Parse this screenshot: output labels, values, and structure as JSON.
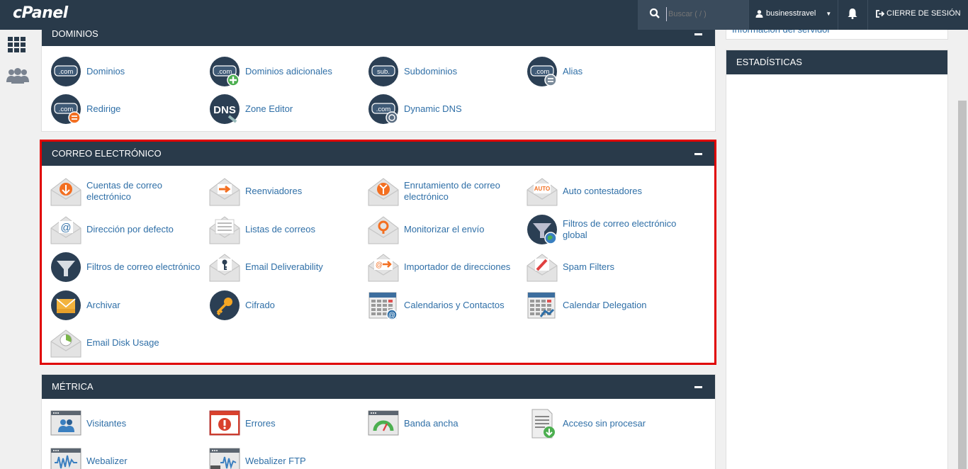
{
  "app": {
    "logo": "cPanel"
  },
  "topbar": {
    "search_placeholder": "Buscar ( / )",
    "username": "businesstravel",
    "logout_label": "CIERRE DE SESIÓN"
  },
  "sidebar": {
    "items": [
      {
        "icon": "grid-icon"
      },
      {
        "icon": "users-icon"
      }
    ]
  },
  "right": {
    "server_info_link": "Información del servidor",
    "stats_title": "ESTADÍSTICAS"
  },
  "sections": {
    "domains": {
      "title": "DOMINIOS",
      "items": [
        {
          "label": "Dominios",
          "icon": "com-icon"
        },
        {
          "label": "Dominios adicionales",
          "icon": "com-add-icon"
        },
        {
          "label": "Subdominios",
          "icon": "sub-icon"
        },
        {
          "label": "Alias",
          "icon": "com-alias-icon"
        },
        {
          "label": "Redirige",
          "icon": "com-redirect-icon"
        },
        {
          "label": "Zone Editor",
          "icon": "dns-icon"
        },
        {
          "label": "Dynamic DNS",
          "icon": "com-dynamic-icon"
        }
      ]
    },
    "email": {
      "title": "CORREO ELECTRÓNICO",
      "items": [
        {
          "label": "Cuentas de correo electrónico",
          "icon": "email-account-icon"
        },
        {
          "label": "Reenviadores",
          "icon": "forwarder-icon"
        },
        {
          "label": "Enrutamiento de correo electrónico",
          "icon": "routing-icon"
        },
        {
          "label": "Auto contestadores",
          "icon": "autoresponder-icon"
        },
        {
          "label": "Dirección por defecto",
          "icon": "default-address-icon"
        },
        {
          "label": "Listas de correos",
          "icon": "mailing-list-icon"
        },
        {
          "label": "Monitorizar el envío",
          "icon": "track-delivery-icon"
        },
        {
          "label": "Filtros de correo electrónico global",
          "icon": "global-filter-icon"
        },
        {
          "label": "Filtros de correo electrónico",
          "icon": "filter-icon"
        },
        {
          "label": "Email Deliverability",
          "icon": "deliverability-icon"
        },
        {
          "label": "Importador de direcciones",
          "icon": "import-icon"
        },
        {
          "label": "Spam Filters",
          "icon": "spam-icon"
        },
        {
          "label": "Archivar",
          "icon": "archive-icon"
        },
        {
          "label": "Cifrado",
          "icon": "key-icon"
        },
        {
          "label": "Calendarios y Contactos",
          "icon": "calendar-contacts-icon"
        },
        {
          "label": "Calendar Delegation",
          "icon": "calendar-delegation-icon"
        },
        {
          "label": "Email Disk Usage",
          "icon": "disk-usage-icon"
        }
      ]
    },
    "metrics": {
      "title": "MÉTRICA",
      "items": [
        {
          "label": "Visitantes",
          "icon": "visitors-icon"
        },
        {
          "label": "Errores",
          "icon": "errors-icon"
        },
        {
          "label": "Banda ancha",
          "icon": "bandwidth-icon"
        },
        {
          "label": "Acceso sin procesar",
          "icon": "raw-access-icon"
        },
        {
          "label": "Webalizer",
          "icon": "webalizer-icon"
        },
        {
          "label": "Webalizer FTP",
          "icon": "webalizer-ftp-icon"
        }
      ]
    }
  },
  "colors": {
    "navy": "#293a4a",
    "link": "#2f6fa7",
    "orange": "#f36f21",
    "highlight": "#e00000"
  }
}
